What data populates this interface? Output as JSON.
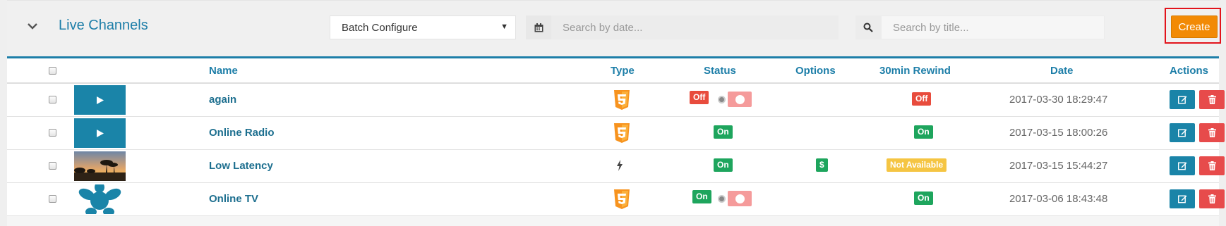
{
  "header": {
    "title": "Live Channels",
    "batch_select": "Batch Configure",
    "date_search_placeholder": "Search by date...",
    "title_search_placeholder": "Search by title...",
    "create_label": "Create"
  },
  "columns": {
    "name": "Name",
    "type": "Type",
    "status": "Status",
    "options": "Options",
    "rewind": "30min Rewind",
    "date": "Date",
    "actions": "Actions"
  },
  "rows": [
    {
      "name": "again",
      "type": "html5",
      "status": "Off",
      "status_toggle": true,
      "option": "",
      "rewind": "Off",
      "date": "2017-03-30 18:29:47",
      "thumb": "play"
    },
    {
      "name": "Online Radio",
      "type": "html5",
      "status": "On",
      "status_toggle": false,
      "option": "",
      "rewind": "On",
      "date": "2017-03-15 18:00:26",
      "thumb": "play"
    },
    {
      "name": "Low Latency",
      "type": "bolt",
      "status": "On",
      "status_toggle": false,
      "option": "$",
      "rewind": "Not Available",
      "date": "2017-03-15 15:44:27",
      "thumb": "landscape"
    },
    {
      "name": "Online TV",
      "type": "html5",
      "status": "On",
      "status_toggle": true,
      "option": "",
      "rewind": "On",
      "date": "2017-03-06 18:43:48",
      "thumb": "star"
    }
  ],
  "colors": {
    "accent": "#1d7ea8",
    "create": "#f28a05",
    "on": "#1ea55d",
    "off": "#e84c3d",
    "not_available": "#f5c543",
    "delete": "#e74b4b"
  },
  "icons": {
    "collapse": "chevron-down-icon",
    "calendar": "calendar-icon",
    "search": "search-icon",
    "play": "play-icon",
    "html5": "html5-icon",
    "bolt": "bolt-icon",
    "edit": "edit-icon",
    "delete": "trash-icon"
  }
}
